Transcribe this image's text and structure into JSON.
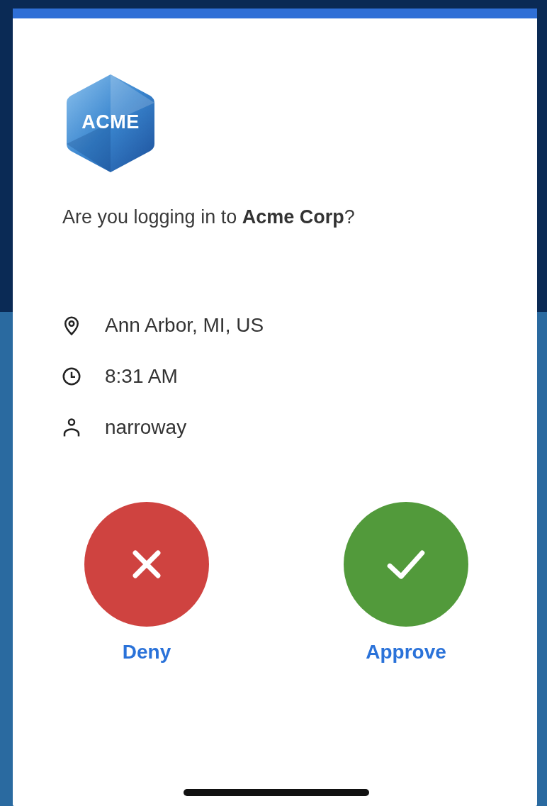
{
  "logo": {
    "text": "ACME"
  },
  "prompt": "Are you logging in to **Acme Corp**?",
  "details": [
    {
      "kind": "location",
      "text": "Ann Arbor, MI, US"
    },
    {
      "kind": "time",
      "text": "8:31 AM"
    },
    {
      "kind": "user",
      "text": "narroway"
    }
  ],
  "actions": [
    {
      "kind": "deny",
      "label": "Deny"
    },
    {
      "kind": "approve",
      "label": "Approve"
    }
  ]
}
